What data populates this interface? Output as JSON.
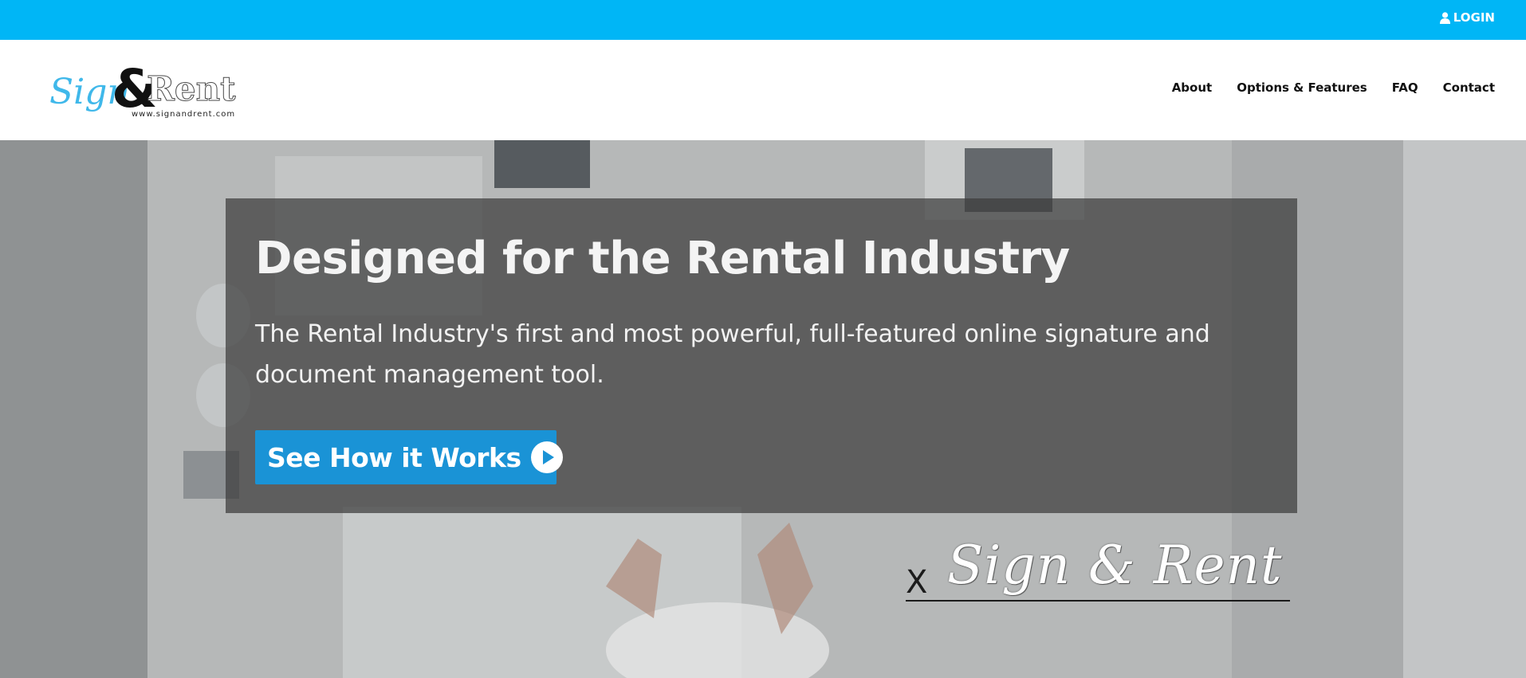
{
  "topbar": {
    "login_label": "LOGIN",
    "login_icon": "user-icon",
    "background": "#00b6f6"
  },
  "header": {
    "logo": {
      "word_sign": "Sign",
      "ampersand": "&",
      "word_rent": "Rent",
      "url": "www.signandrent.com"
    },
    "nav": [
      {
        "label": "About"
      },
      {
        "label": "Options & Features"
      },
      {
        "label": "FAQ"
      },
      {
        "label": "Contact"
      }
    ]
  },
  "hero": {
    "title": "Designed for the Rental Industry",
    "subtitle": "The Rental Industry's first and most powerful, full-featured online signature and document management tool.",
    "cta_label": "See How it Works",
    "cta_icon": "play-circle-icon",
    "cta_color": "#1a93d6",
    "signature": {
      "x_mark": "X",
      "text": "Sign & Rent"
    }
  }
}
